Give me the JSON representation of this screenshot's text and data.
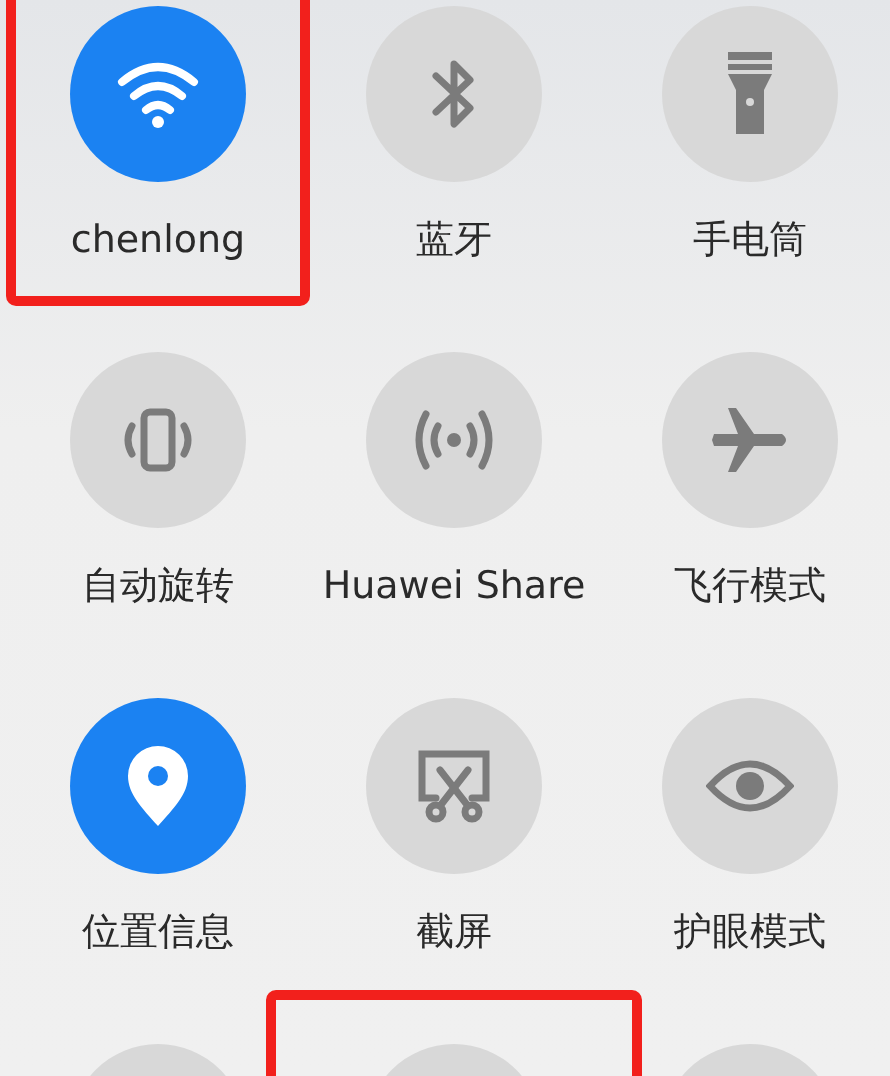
{
  "tiles": [
    {
      "label": "chenlong",
      "on": true,
      "highlighted": true
    },
    {
      "label": "蓝牙",
      "on": false,
      "highlighted": false
    },
    {
      "label": "手电筒",
      "on": false,
      "highlighted": false
    },
    {
      "label": "自动旋转",
      "on": false,
      "highlighted": false
    },
    {
      "label": "Huawei Share",
      "on": false,
      "highlighted": false
    },
    {
      "label": "飞行模式",
      "on": false,
      "highlighted": false
    },
    {
      "label": "位置信息",
      "on": true,
      "highlighted": false
    },
    {
      "label": "截屏",
      "on": false,
      "highlighted": false
    },
    {
      "label": "护眼模式",
      "on": false,
      "highlighted": false
    },
    {
      "on": false,
      "highlighted": false
    },
    {
      "on": false,
      "highlighted": true
    },
    {
      "on": false,
      "highlighted": false
    }
  ]
}
